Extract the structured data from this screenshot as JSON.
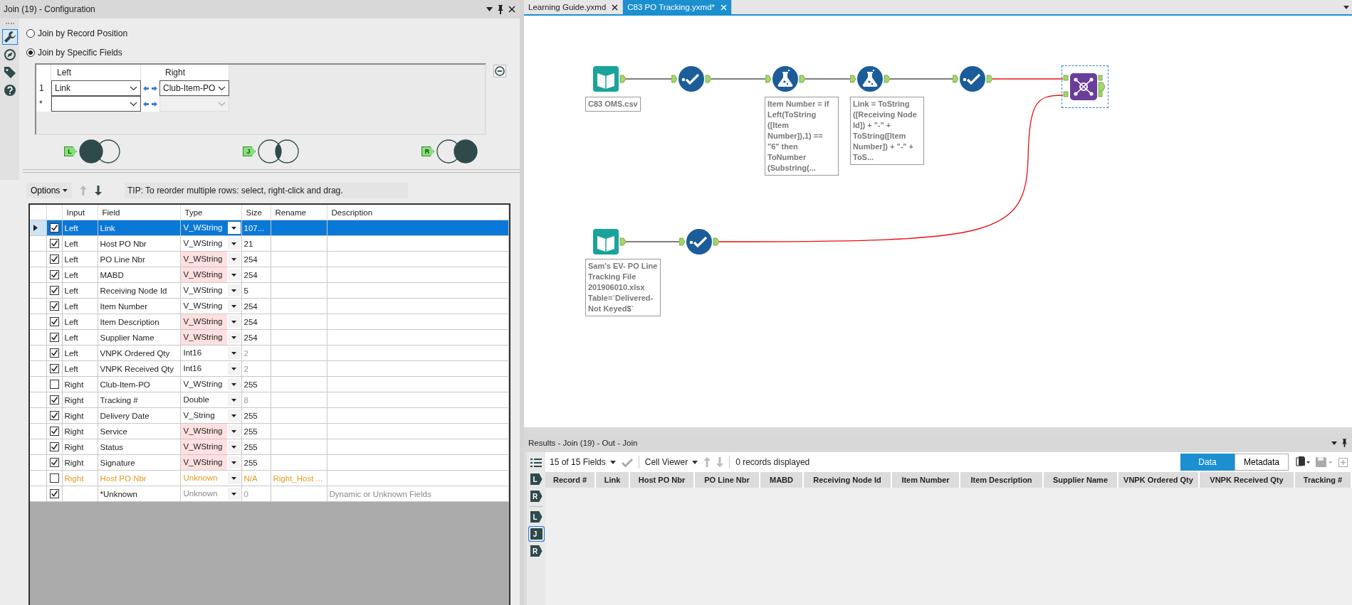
{
  "config_panel": {
    "title": "Join (19) - Configuration",
    "sidebar": [
      {
        "kind": "configure",
        "selected": true
      },
      {
        "kind": "annotation",
        "selected": false
      },
      {
        "kind": "tag",
        "selected": false
      },
      {
        "kind": "help",
        "selected": false
      }
    ],
    "join_modes": [
      {
        "label": "Join by Record Position",
        "selected": false
      },
      {
        "label": "Join by Specific Fields",
        "selected": true
      }
    ],
    "join_fields": {
      "columns": [
        "Left",
        "Right"
      ],
      "rows": [
        {
          "number": "1",
          "left": "Link",
          "right": "Club-Item-PO",
          "right_disabled": false
        },
        {
          "number": "*",
          "right_disabled": true
        }
      ]
    },
    "venn": [
      {
        "label": "L",
        "kind": "left"
      },
      {
        "label": "J",
        "kind": "inner"
      },
      {
        "label": "R",
        "kind": "right"
      }
    ],
    "toolbar": {
      "options": "Options",
      "tip": "TIP: To reorder multiple rows: select, right-click and drag."
    },
    "fields_table": {
      "columns": [
        "Input",
        "Field",
        "Type",
        "Size",
        "Rename",
        "Description"
      ],
      "rows": [
        {
          "kind": "field",
          "selected": true,
          "checked": true,
          "input": "Left",
          "field": "Link",
          "type": "V_WString",
          "type_flagged": false,
          "size": "107...",
          "size_dim": false
        },
        {
          "kind": "field",
          "selected": false,
          "checked": true,
          "input": "Left",
          "field": "Host PO Nbr",
          "type": "V_WString",
          "type_flagged": false,
          "size": "21",
          "size_dim": false
        },
        {
          "kind": "field",
          "selected": false,
          "checked": true,
          "input": "Left",
          "field": "PO Line Nbr",
          "type": "V_WString",
          "type_flagged": true,
          "size": "254",
          "size_dim": false
        },
        {
          "kind": "field",
          "selected": false,
          "checked": true,
          "input": "Left",
          "field": "MABD",
          "type": "V_WString",
          "type_flagged": true,
          "size": "254",
          "size_dim": false
        },
        {
          "kind": "field",
          "selected": false,
          "checked": true,
          "input": "Left",
          "field": "Receiving Node Id",
          "type": "V_WString",
          "type_flagged": false,
          "size": "5",
          "size_dim": false
        },
        {
          "kind": "field",
          "selected": false,
          "checked": true,
          "input": "Left",
          "field": "Item Number",
          "type": "V_WString",
          "type_flagged": false,
          "size": "254",
          "size_dim": false
        },
        {
          "kind": "field",
          "selected": false,
          "checked": true,
          "input": "Left",
          "field": "Item Description",
          "type": "V_WString",
          "type_flagged": true,
          "size": "254",
          "size_dim": false
        },
        {
          "kind": "field",
          "selected": false,
          "checked": true,
          "input": "Left",
          "field": "Supplier Name",
          "type": "V_WString",
          "type_flagged": true,
          "size": "254",
          "size_dim": false
        },
        {
          "kind": "field",
          "selected": false,
          "checked": true,
          "input": "Left",
          "field": "VNPK Ordered Qty",
          "type": "Int16",
          "type_flagged": false,
          "size": "2",
          "size_dim": true
        },
        {
          "kind": "field",
          "selected": false,
          "checked": true,
          "input": "Left",
          "field": "VNPK Received Qty",
          "type": "Int16",
          "type_flagged": false,
          "size": "2",
          "size_dim": true
        },
        {
          "kind": "field",
          "selected": false,
          "checked": false,
          "input": "Right",
          "field": "Club-Item-PO",
          "type": "V_WString",
          "type_flagged": false,
          "size": "255",
          "size_dim": false
        },
        {
          "kind": "field",
          "selected": false,
          "checked": true,
          "input": "Right",
          "field": "Tracking #",
          "type": "Double",
          "type_flagged": false,
          "size": "8",
          "size_dim": true
        },
        {
          "kind": "field",
          "selected": false,
          "checked": true,
          "input": "Right",
          "field": "Delivery Date",
          "type": "V_String",
          "type_flagged": false,
          "size": "255",
          "size_dim": false
        },
        {
          "kind": "field",
          "selected": false,
          "checked": true,
          "input": "Right",
          "field": "Service",
          "type": "V_WString",
          "type_flagged": true,
          "size": "255",
          "size_dim": false
        },
        {
          "kind": "field",
          "selected": false,
          "checked": true,
          "input": "Right",
          "field": "Status",
          "type": "V_WString",
          "type_flagged": true,
          "size": "255",
          "size_dim": false
        },
        {
          "kind": "field",
          "selected": false,
          "checked": true,
          "input": "Right",
          "field": "Signature",
          "type": "V_WString",
          "type_flagged": true,
          "size": "255",
          "size_dim": false
        },
        {
          "kind": "missing",
          "selected": false,
          "checked": false,
          "input": "Right",
          "field": "Host PO Nbr",
          "type": "Unknown",
          "type_flagged": false,
          "size": "N/A",
          "size_dim": false,
          "rename": "Right_Host ..."
        },
        {
          "kind": "dynamic",
          "selected": false,
          "checked": true,
          "field": "*Unknown",
          "type": "Unknown",
          "type_flagged": false,
          "size": "0",
          "size_dim": true,
          "description": "Dynamic or Unknown Fields"
        }
      ]
    }
  },
  "tabs": [
    {
      "label": "Learning Guide.yxmd",
      "selected": false
    },
    {
      "label": "C83 PO Tracking.yxmd*",
      "selected": true
    }
  ],
  "workflow": {
    "tools": [
      {
        "kind": "input",
        "annotation": "C83 OMS.csv"
      },
      {
        "kind": "select"
      },
      {
        "kind": "formula",
        "annotation": "Item Number = if\nLeft(ToString\n([Item\nNumber]),1) ==\n\"6\" then\nToNumber\n(Substring(..."
      },
      {
        "kind": "formula",
        "annotation": "Link = ToString\n([Receiving Node\nId]) + \"-\" +\nToString([Item\nNumber]) + \"-\" +\nToS..."
      },
      {
        "kind": "select"
      },
      {
        "kind": "join",
        "selected": true
      },
      {
        "kind": "input",
        "annotation": "Sam's EV- PO Line\nTracking File\n201906010.xlsx\nTable=`Delivered-\nNot Keyed$`"
      },
      {
        "kind": "select"
      }
    ]
  },
  "results": {
    "title": "Results - Join (19) - Out - Join",
    "fields_filter": "15 of 15 Fields",
    "viewer": "Cell Viewer",
    "records": "0 records displayed",
    "views": [
      {
        "label": "Data",
        "selected": true
      },
      {
        "label": "Metadata",
        "selected": false
      }
    ],
    "anchors": [
      {
        "label": "L",
        "selected": false
      },
      {
        "label": "R",
        "selected": false
      },
      {
        "label": "L",
        "selected": false
      },
      {
        "label": "J",
        "selected": true
      },
      {
        "label": "R",
        "selected": false
      }
    ],
    "columns": [
      "Record #",
      "Link",
      "Host PO Nbr",
      "PO Line Nbr",
      "MABD",
      "Receiving Node Id",
      "Item Number",
      "Item Description",
      "Supplier Name",
      "VNPK Ordered Qty",
      "VNPK Received Qty",
      "Tracking #"
    ]
  }
}
